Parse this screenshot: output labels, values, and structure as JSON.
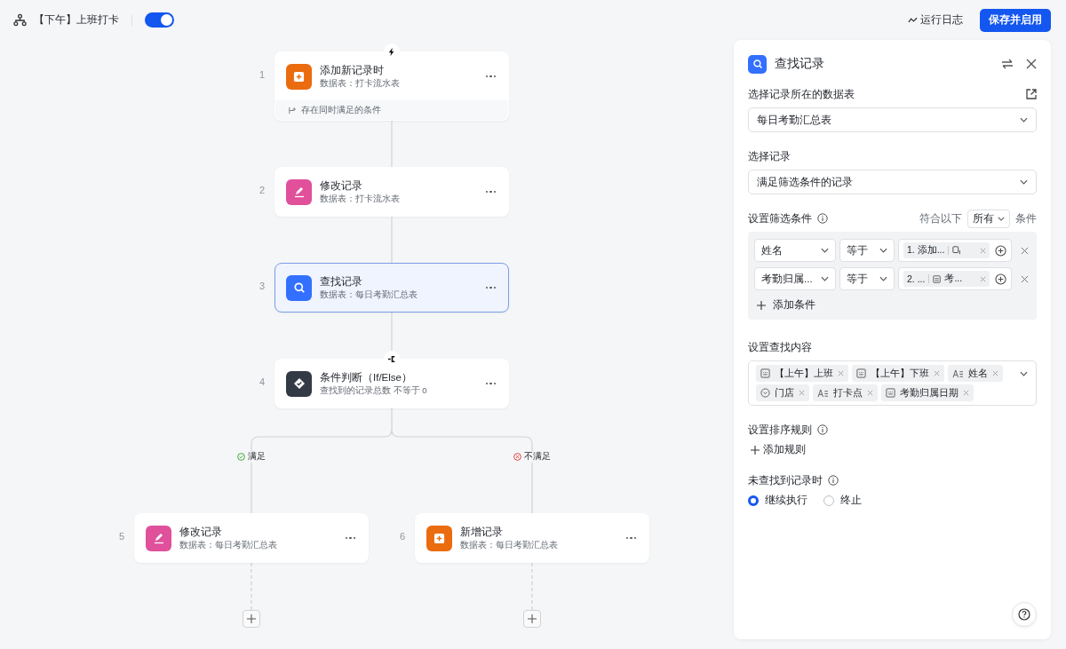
{
  "header": {
    "title": "【下午】上班打卡",
    "enabled": true,
    "log_link": "运行日志",
    "save_button": "保存并启用"
  },
  "nodes": [
    {
      "number": "1",
      "kind": "trigger",
      "title": "添加新记录时",
      "subtitle": "数据表：打卡流水表",
      "footer": "存在同时满足的条件",
      "selected": false
    },
    {
      "number": "2",
      "kind": "edit",
      "title": "修改记录",
      "subtitle": "数据表：打卡流水表",
      "selected": false
    },
    {
      "number": "3",
      "kind": "find",
      "title": "查找记录",
      "subtitle": "数据表：每日考勤汇总表",
      "selected": true
    },
    {
      "number": "4",
      "kind": "condition",
      "title": "条件判断（If/Else）",
      "subtitle": "查找到的记录总数 不等于 0",
      "selected": false
    }
  ],
  "branches": [
    {
      "kind": "yes",
      "label": "满足",
      "nodes": [
        {
          "number": "5",
          "kind": "edit",
          "title": "修改记录",
          "subtitle": "数据表：每日考勤汇总表",
          "selected": false
        }
      ]
    },
    {
      "kind": "no",
      "label": "不满足",
      "nodes": [
        {
          "number": "6",
          "kind": "add",
          "title": "新增记录",
          "subtitle": "数据表：每日考勤汇总表",
          "selected": false
        }
      ]
    }
  ],
  "panel": {
    "title": "查找记录",
    "table_label": "选择记录所在的数据表",
    "table_value": "每日考勤汇总表",
    "record_label": "选择记录",
    "record_value": "满足筛选条件的记录",
    "filter_label": "设置筛选条件",
    "match_prefix": "符合以下",
    "match_value": "所有",
    "match_suffix": "条件",
    "conditions": [
      {
        "field": "姓名",
        "operator": "等于",
        "step": "1. 添加...",
        "kind": "person"
      },
      {
        "field": "考勤归属...",
        "operator": "等于",
        "step": "2. ...",
        "kind": "date",
        "value_field": "考..."
      }
    ],
    "add_condition": "添加条件",
    "content_label": "设置查找内容",
    "content_tags": [
      {
        "kind": "date",
        "text": "【上午】上班"
      },
      {
        "kind": "date",
        "text": "【上午】下班"
      },
      {
        "kind": "text",
        "text": "姓名"
      },
      {
        "kind": "select",
        "text": "门店"
      },
      {
        "kind": "text",
        "text": "打卡点"
      },
      {
        "kind": "date",
        "text": "考勤归属日期"
      }
    ],
    "sort_label": "设置排序规则",
    "add_rule": "添加规则",
    "notfound_label": "未查找到记录时",
    "options": [
      {
        "label": "继续执行",
        "selected": true
      },
      {
        "label": "终止",
        "selected": false
      }
    ]
  }
}
